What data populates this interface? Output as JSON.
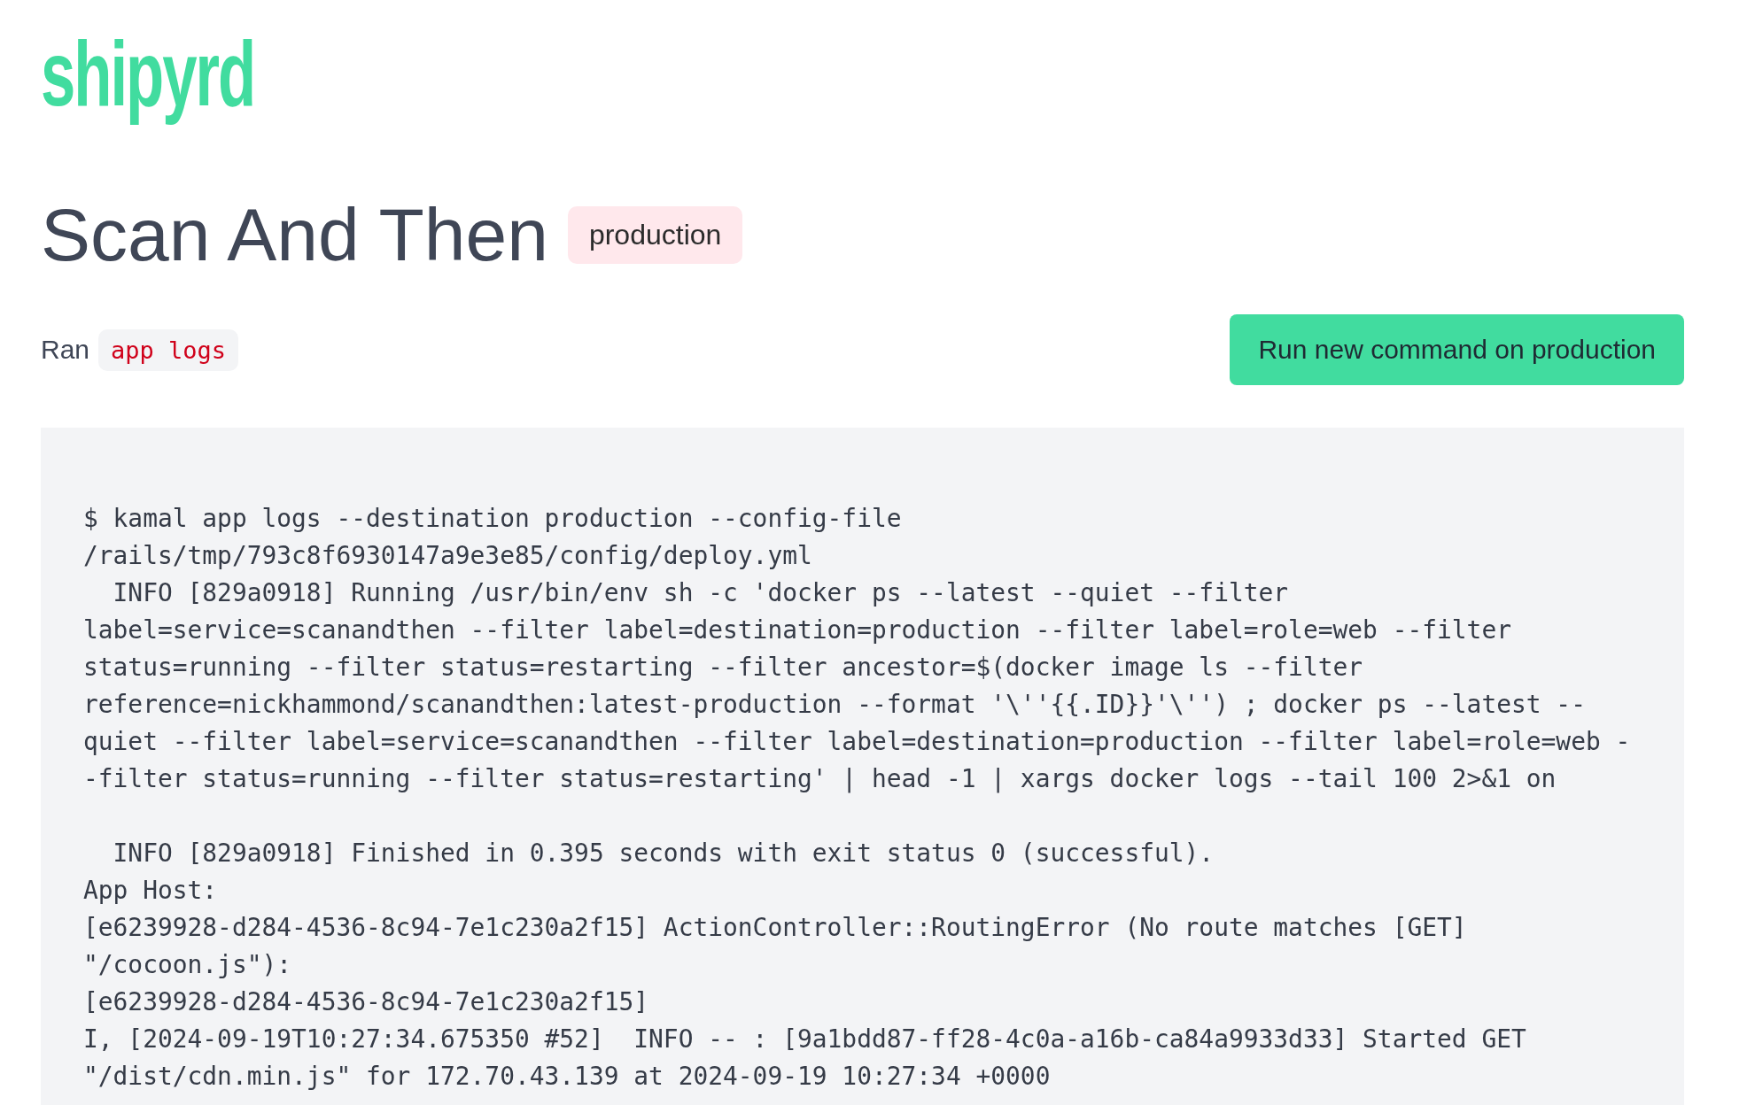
{
  "logo": "shipyrd",
  "title": "Scan And Then",
  "environment_badge": "production",
  "ran": {
    "label": "Ran",
    "command": "app logs"
  },
  "run_button": "Run new command on production",
  "log_blocks": [
    [
      "$ kamal app logs --destination production --config-file",
      "/rails/tmp/793c8f6930147a9e3e85/config/deploy.yml",
      "  INFO [829a0918] Running /usr/bin/env sh -c 'docker ps --latest --quiet --filter",
      "label=service=scanandthen --filter label=destination=production --filter label=role=web --filter",
      "status=running --filter status=restarting --filter ancestor=$(docker image ls --filter",
      "reference=nickhammond/scanandthen:latest-production --format '\\''{{.ID}}'\\'') ; docker ps --latest --",
      "quiet --filter label=service=scanandthen --filter label=destination=production --filter label=role=web -",
      "-filter status=running --filter status=restarting' | head -1 | xargs docker logs --tail 100 2>&1 on"
    ],
    [
      "  INFO [829a0918] Finished in 0.395 seconds with exit status 0 (successful).",
      "App Host:",
      "[e6239928-d284-4536-8c94-7e1c230a2f15] ActionController::RoutingError (No route matches [GET]",
      "\"/cocoon.js\"):",
      "[e6239928-d284-4536-8c94-7e1c230a2f15]",
      "I, [2024-09-19T10:27:34.675350 #52]  INFO -- : [9a1bdd87-ff28-4c0a-a16b-ca84a9933d33] Started GET",
      "\"/dist/cdn.min.js\" for 172.70.43.139 at 2024-09-19 10:27:34 +0000"
    ]
  ]
}
